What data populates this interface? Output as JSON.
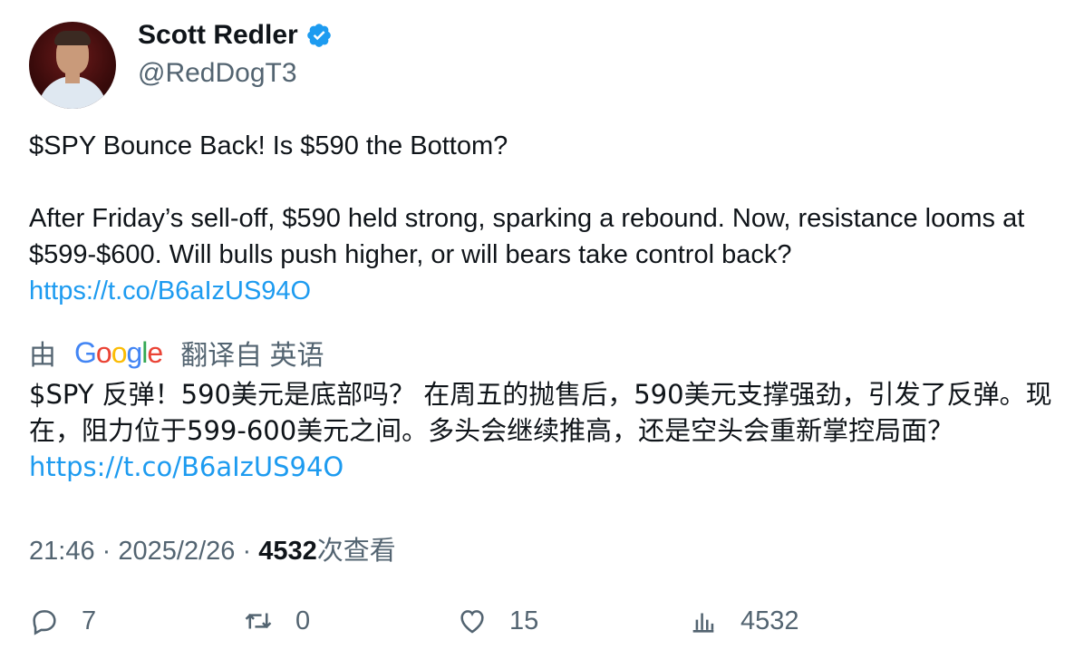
{
  "author": {
    "name": "Scott Redler",
    "handle": "@RedDogT3"
  },
  "tweet": {
    "line1": "$SPY Bounce Back! Is $590 the Bottom?",
    "line2": "After Friday’s sell-off, $590 held strong, sparking a rebound. Now, resistance looms at $599-$600. Will bulls push higher, or will bears take control back?",
    "link": "https://t.co/B6aIzUS94O"
  },
  "translation": {
    "by_label": "由",
    "provider": "Google",
    "label": "翻译自 英语",
    "text": "$SPY 反弹！590美元是底部吗？ 在周五的抛售后，590美元支撑强劲，引发了反弹。现在，阻力位于599-600美元之间。多头会继续推高，还是空头会重新掌控局面？",
    "link": "https://t.co/B6aIzUS94O"
  },
  "meta": {
    "time": "21:46",
    "separator": "·",
    "date": "2025/2/26",
    "views_count": "4532",
    "views_label": "次查看"
  },
  "actions": {
    "replies": "7",
    "retweets": "0",
    "likes": "15",
    "views": "4532"
  },
  "colors": {
    "link": "#1d9bf0",
    "muted": "#536471",
    "verified": "#1d9bf0"
  }
}
